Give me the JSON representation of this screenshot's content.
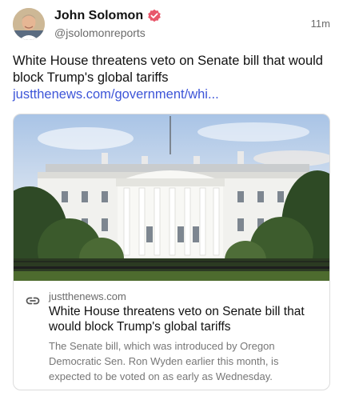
{
  "author": {
    "display_name": "John Solomon",
    "handle": "@jsolomonreports",
    "verified_color": "#e8566a"
  },
  "timestamp": "11m",
  "post": {
    "text": "White House threatens veto on Senate bill that would block Trump's global tariffs ",
    "link_text": "justthenews.com/government/whi..."
  },
  "card": {
    "image_subject": "White House south facade with trees and fence",
    "domain": "justthenews.com",
    "title": "White House threatens veto on Senate bill that would block Trump's global tariffs",
    "description": "The Senate bill, which was introduced by Oregon Democratic Sen. Ron Wyden earlier this month, is expected to be voted on as early as Wednesday.",
    "icon": "link-icon"
  },
  "colors": {
    "link": "#3d55d8",
    "text": "#111111",
    "muted": "#6b6b6b",
    "border": "#dcdcdc"
  }
}
